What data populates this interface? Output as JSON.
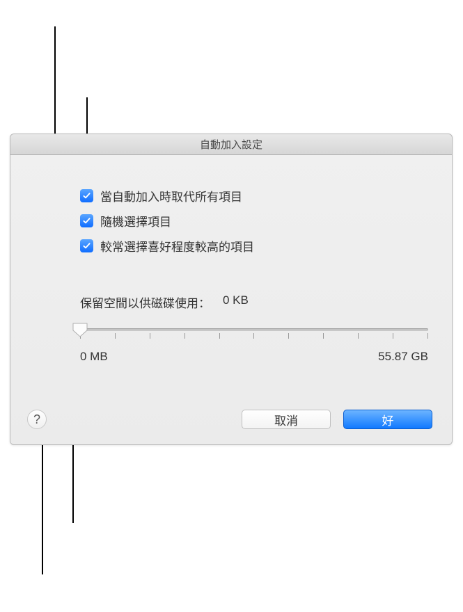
{
  "window": {
    "title": "自動加入設定"
  },
  "checkboxes": [
    {
      "label": "當自動加入時取代所有項目",
      "checked": true
    },
    {
      "label": "隨機選擇項目",
      "checked": true
    },
    {
      "label": "較常選擇喜好程度較高的項目",
      "checked": true
    }
  ],
  "slider": {
    "label": "保留空間以供磁碟使用：",
    "value": "0 KB",
    "min_label": "0 MB",
    "max_label": "55.87 GB"
  },
  "buttons": {
    "cancel": "取消",
    "ok": "好",
    "help": "?"
  }
}
